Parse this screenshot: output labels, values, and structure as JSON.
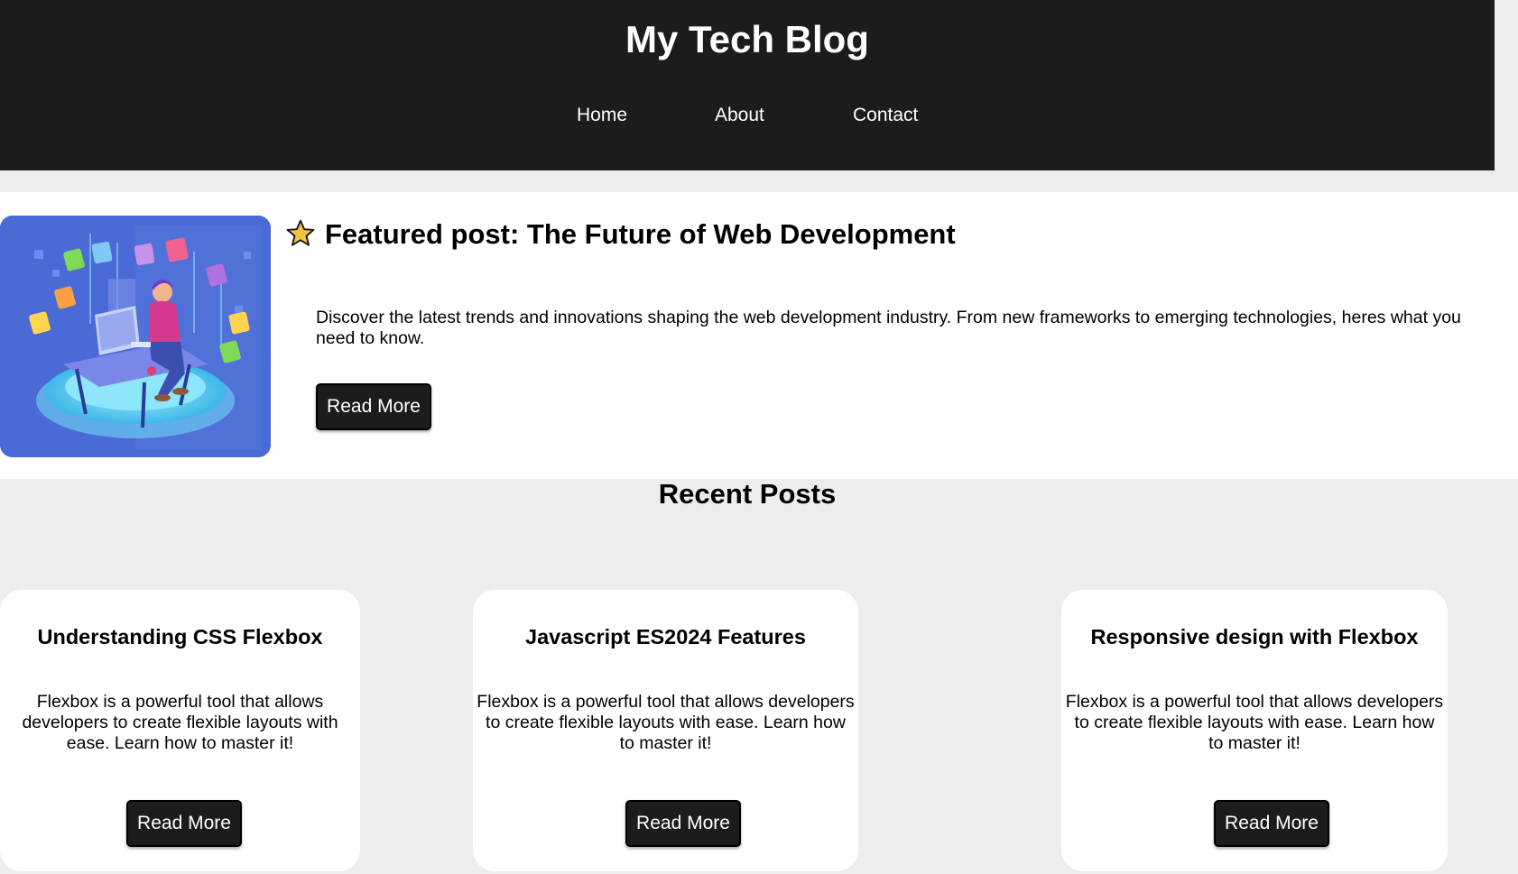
{
  "header": {
    "title": "My Tech Blog",
    "nav": [
      "Home",
      "About",
      "Contact"
    ]
  },
  "featured": {
    "icon": "star-icon",
    "title": "Featured post: The Future of Web Development",
    "text": "Discover the latest trends and innovations shaping the web development industry. From new frameworks to emerging technologies, heres what you need to know.",
    "button": "Read More"
  },
  "recent": {
    "title": "Recent Posts",
    "posts": [
      {
        "title": "Understanding CSS Flexbox",
        "text": "Flexbox is a powerful tool that allows developers to create flexible layouts with ease. Learn how to master it!",
        "button": "Read More"
      },
      {
        "title": "Javascript ES2024 Features",
        "text": "Flexbox is a powerful tool that allows developers to create flexible layouts with ease. Learn how to master it!",
        "button": "Read More"
      },
      {
        "title": "Responsive design with Flexbox",
        "text": "Flexbox is a powerful tool that allows developers to create flexible layouts with ease. Learn how to master it!",
        "button": "Read More"
      }
    ]
  },
  "colors": {
    "header_bg": "#1c1c1c",
    "page_bg": "#ededed",
    "card_bg": "#ffffff",
    "button_bg": "#1c1c1c",
    "star": "#f5c542"
  }
}
